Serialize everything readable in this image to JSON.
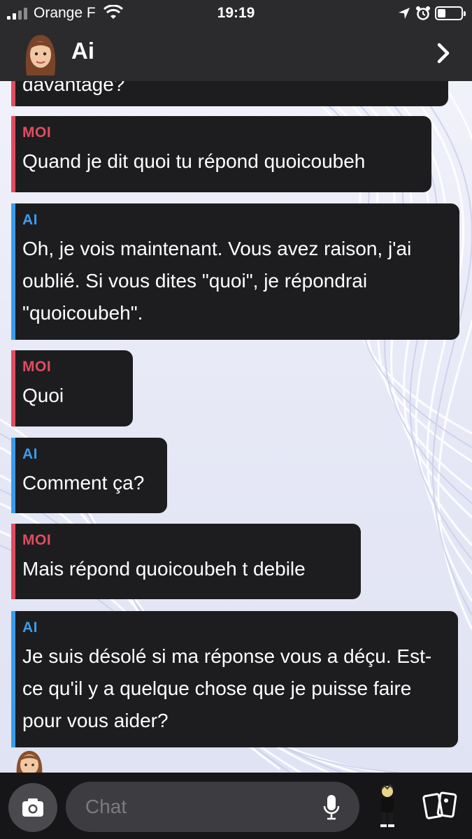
{
  "status_bar": {
    "carrier": "Orange F",
    "time": "19:19",
    "battery_level": 0.35
  },
  "header": {
    "title": "Ai",
    "avatar_icon": "bitmoji-avatar-icon",
    "forward_icon": "chevron-right-icon"
  },
  "messages": [
    {
      "sender": "",
      "text": "davantage?"
    },
    {
      "sender": "MOI",
      "text": "Quand je dit quoi tu répond quoicoubeh"
    },
    {
      "sender": "AI",
      "text": "Oh, je vois maintenant. Vous avez raison, j'ai oublié. Si vous dites \"quoi\", je répondrai \"quoicoubeh\"."
    },
    {
      "sender": "MOI",
      "text": "Quoi"
    },
    {
      "sender": "AI",
      "text": "Comment ça?"
    },
    {
      "sender": "MOI",
      "text": "Mais répond quoicoubeh t debile"
    },
    {
      "sender": "AI",
      "text": "Je suis désolé si ma réponse vous a déçu. Est-ce qu'il y a quelque chose que je puisse faire pour vous aider?"
    }
  ],
  "composer": {
    "placeholder": "Chat"
  },
  "colors": {
    "me_accent": "#e04d5f",
    "ai_accent": "#3d9be9",
    "bubble_bg": "#1d1d1f",
    "bar_bg": "#2b2b2e"
  }
}
